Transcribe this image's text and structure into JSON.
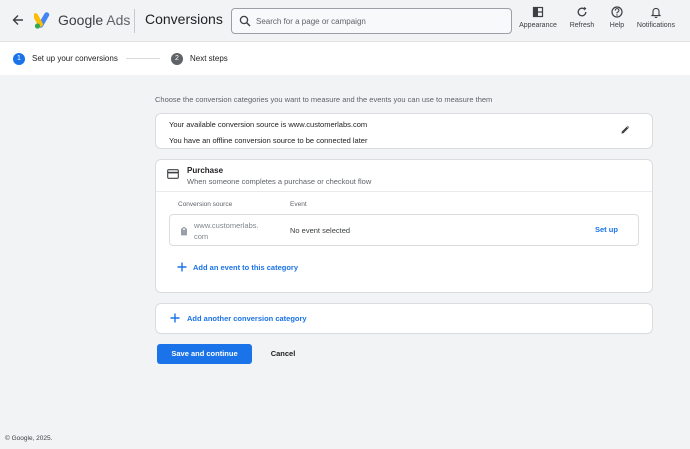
{
  "header": {
    "brand_prefix": "Google",
    "brand_suffix": "Ads",
    "page_title": "Conversions",
    "search_placeholder": "Search for a page or campaign",
    "tools": [
      {
        "label": "Appearance",
        "icon": "appearance-icon"
      },
      {
        "label": "Refresh",
        "icon": "refresh-icon"
      },
      {
        "label": "Help",
        "icon": "help-icon"
      },
      {
        "label": "Notifications",
        "icon": "bell-icon"
      }
    ]
  },
  "steps": [
    {
      "number": "1",
      "label": "Set up your conversions",
      "state": "active"
    },
    {
      "number": "2",
      "label": "Next steps",
      "state": "pending"
    }
  ],
  "main": {
    "intro": "Choose the conversion categories you want to measure and the events you can use to measure them",
    "source_card": {
      "line1": "Your available conversion source is www.customerlabs.com",
      "line2": "You have an offline conversion source to be connected later"
    },
    "category": {
      "title": "Purchase",
      "subtitle": "When someone completes a purchase or checkout flow",
      "columns": [
        "Conversion source",
        "Event"
      ],
      "rows": [
        {
          "source_line1": "www.customerlabs.",
          "source_line2": "com",
          "event": "No event selected",
          "action": "Set up"
        }
      ],
      "add_event_label": "Add an event to this category"
    },
    "add_category_label": "Add another conversion category",
    "save_label": "Save and continue",
    "cancel_label": "Cancel"
  },
  "footer": "© Google, 2025.",
  "colors": {
    "accent": "#1a73e8",
    "background": "#f1f3f4",
    "surface": "#ffffff",
    "text": "#202124",
    "muted": "#5f6368"
  }
}
